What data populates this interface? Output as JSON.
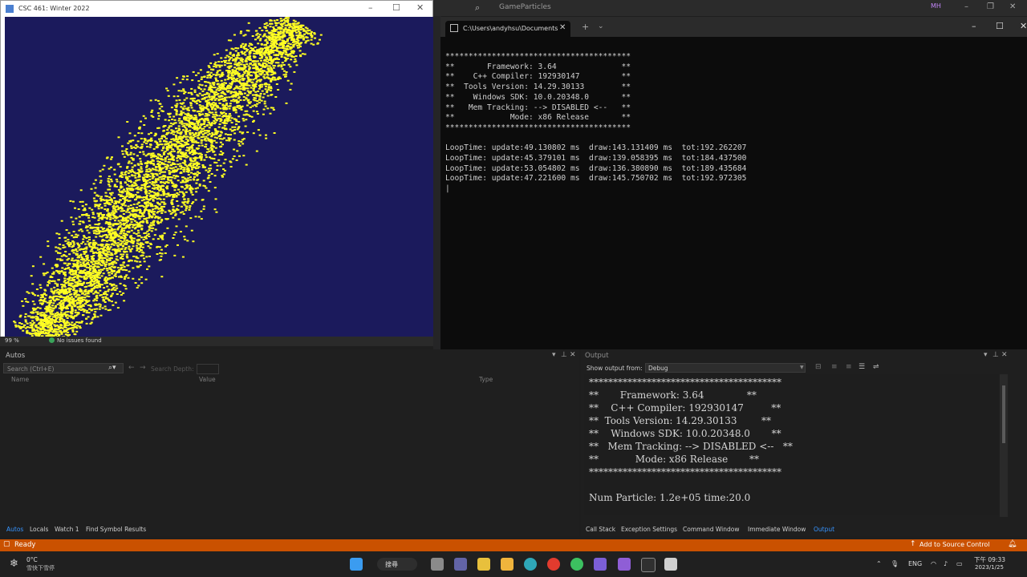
{
  "vs": {
    "project_name": "GameParticles",
    "user_initials": "MH",
    "zoom": "99 %",
    "issues": "No issues found"
  },
  "particle_window": {
    "title": "CSC 461: Winter 2022",
    "bg_color": "#1b1a5c",
    "particle_color": "#ffff22"
  },
  "terminal": {
    "tab_title": "C:\\Users\\andyhsu\\Documents",
    "lines": [
      "****************************************",
      "**       Framework: 3.64              **",
      "**    C++ Compiler: 192930147         **",
      "**  Tools Version: 14.29.30133        **",
      "**    Windows SDK: 10.0.20348.0       **",
      "**   Mem Tracking: --> DISABLED <--   **",
      "**            Mode: x86 Release       **",
      "****************************************",
      "",
      "LoopTime: update:49.130802 ms  draw:143.131409 ms  tot:192.262207",
      "LoopTime: update:45.379101 ms  draw:139.058395 ms  tot:184.437500",
      "LoopTime: update:53.054802 ms  draw:136.380890 ms  tot:189.435684",
      "LoopTime: update:47.221600 ms  draw:145.750702 ms  tot:192.972305",
      "|"
    ]
  },
  "autos": {
    "title": "Autos",
    "search_placeholder": "Search (Ctrl+E)",
    "search_depth": "Search Depth:",
    "columns": [
      "Name",
      "Value",
      "Type"
    ],
    "tabs": [
      "Autos",
      "Locals",
      "Watch 1",
      "Find Symbol Results"
    ]
  },
  "output": {
    "title": "Output",
    "show_from_label": "Show output from:",
    "show_from_value": "Debug",
    "lines": [
      "****************************************",
      "**       Framework: 3.64              **",
      "**    C++ Compiler: 192930147         **",
      "**  Tools Version: 14.29.30133        **",
      "**    Windows SDK: 10.0.20348.0       **",
      "**   Mem Tracking: --> DISABLED <--   **",
      "**            Mode: x86 Release       **",
      "****************************************",
      "",
      "Num Particle: 1.2e+05 time:20.0"
    ],
    "tabs": [
      "Call Stack",
      "Exception Settings",
      "Command Window",
      "Immediate Window",
      "Output"
    ]
  },
  "status": {
    "ready": "Ready",
    "source_control": "Add to Source Control",
    "accent": "#ca5100"
  },
  "taskbar": {
    "weather_temp": "0°C",
    "weather_desc": "雪快下雪停",
    "search_label": "搜尋",
    "ime": "ENG",
    "time": "下午 09:33",
    "date": "2023/1/25"
  }
}
